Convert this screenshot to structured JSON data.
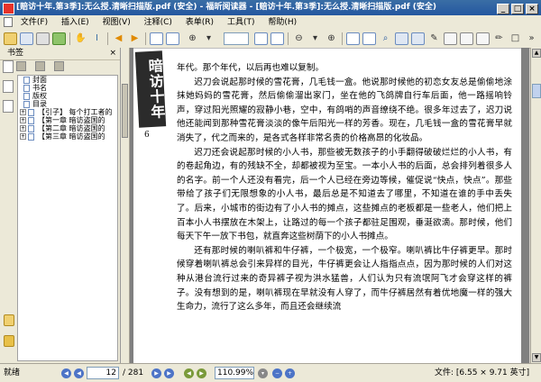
{
  "window": {
    "title": "[赔访十年.第3季]:无么授.清晰扫描版.pdf (安全) - 福昕阅读器 - [赔访十年.第3季]:无么授.清晰扫描版.pdf (安全)",
    "minimize_label": "_",
    "maximize_label": "□",
    "close_label": "×"
  },
  "menu": {
    "items": [
      "文件(F)",
      "插入(E)",
      "视图(V)",
      "注释(C)",
      "表单(R)",
      "工具(T)",
      "帮助(H)"
    ]
  },
  "toolbar": {
    "zoom_value": ""
  },
  "sidebar": {
    "title": "书签",
    "close_label": "×",
    "bookmarks": [
      {
        "label": "封面",
        "expandable": false
      },
      {
        "label": "书名",
        "expandable": false
      },
      {
        "label": "版权",
        "expandable": false
      },
      {
        "label": "目录",
        "expandable": false
      },
      {
        "label": "【引子】 每个打工者的",
        "expandable": true
      },
      {
        "label": "【第一章 暗访盗国的",
        "expandable": true
      },
      {
        "label": "【第二章 暗访盗国的",
        "expandable": true
      },
      {
        "label": "【第三章 暗访盗国的",
        "expandable": true
      }
    ],
    "expand_symbol": "+"
  },
  "document": {
    "stamp_text": "暗访十年",
    "page_number": "6",
    "paragraphs": [
      {
        "indent": false,
        "text": "年代。那个年代，以后再也难以复制。"
      },
      {
        "indent": true,
        "text": "迟刀会说起那时候的雪花膏，几毛钱一盒。他说那时候他的初恋女友总是偷偷地涂抹她妈妈的雪花膏，然后偷偷溜出家门，坐在他的飞鸽牌自行车后面，他一路摇响铃声，穿过阳光照耀的寂静小巷，空中，有鸽哨的声音缭绕不绝。很多年过去了，迟刀说他还能闻到那种雪花膏淡淡的像午后阳光一样的芳香。现在，几毛钱一盒的雪花膏早就消失了，代之而来的，是各式各样非常名贵的价格高昂的化妆品。"
      },
      {
        "indent": true,
        "text": "迟刀还会说起那时候的小人书，那些被无数孩子的小手翻得破破烂烂的小人书，有的卷起角边，有的残缺不全，却都被视为至宝。一本小人书的后面，总会排列着很多人的名字。前一个人还没有看完，后一个人已经在旁边等候，催促说“快点，快点”。那些带给了孩子们无限想象的小人书，最后总是不知道去了哪里，不知道在谁的手中丢失了。后来，小城市的街边有了小人书的摊点，这些摊点的老板都是一些老人，他们把上百本小人书摆放在木架上，让路过的每一个孩子都驻足围观，垂涎欲滴。那时候，他们每天下午一放下书包，就直奔这些树荫下的小人书摊点。"
      },
      {
        "indent": true,
        "text": "还有那时候的喇叭裤和牛仔裤，一个极宽，一个极窄。喇叭裤比牛仔裤更早。那时候穿着喇叭裤总会引来异样的目光，牛仔裤更会让人指指点点，因为那时候的人们对这种从港台流行过来的奇异裤子视为洪水猛兽，人们认为只有流氓阿飞才会穿这样的裤子。没有想到的是，喇叭裤现在早就没有人穿了，而牛仔裤居然有着优地魔一样的强大生命力，流行了这么多年，而且还会继续流"
      }
    ]
  },
  "status": {
    "ready": "就绪",
    "current_page": "12",
    "total_pages": "/ 281",
    "zoom": "110.99%",
    "file_info": "文件: [6.55 × 9.71 英寸]"
  },
  "colors": {
    "titlebar": "#2457a0",
    "chrome": "#ece9d8",
    "doc_background": "#808080"
  }
}
